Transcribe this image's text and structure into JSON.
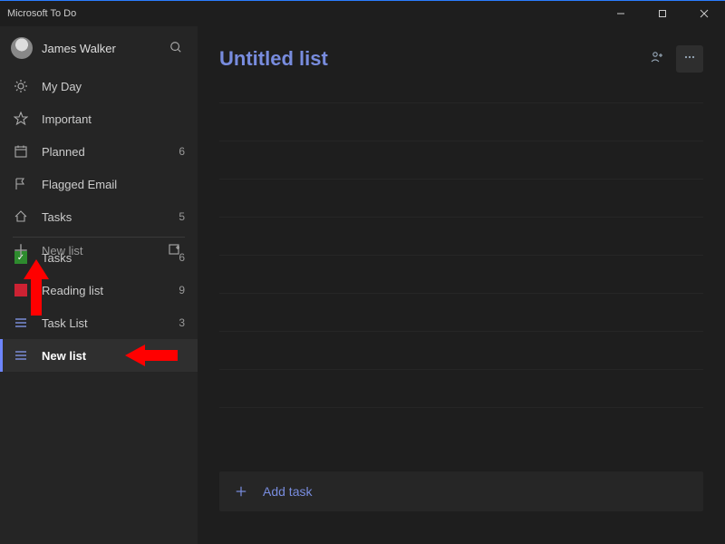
{
  "window": {
    "title": "Microsoft To Do"
  },
  "user": {
    "name": "James Walker"
  },
  "smart_lists": [
    {
      "key": "myday",
      "label": "My Day",
      "count": ""
    },
    {
      "key": "important",
      "label": "Important",
      "count": ""
    },
    {
      "key": "planned",
      "label": "Planned",
      "count": "6"
    },
    {
      "key": "flagged",
      "label": "Flagged Email",
      "count": ""
    },
    {
      "key": "tasks",
      "label": "Tasks",
      "count": "5"
    }
  ],
  "custom_lists": [
    {
      "key": "tasks2",
      "label": "Tasks",
      "count": "6"
    },
    {
      "key": "reading",
      "label": "Reading list",
      "count": "9"
    },
    {
      "key": "tasklist",
      "label": "Task List",
      "count": "3"
    },
    {
      "key": "newlist",
      "label": "New list",
      "count": "",
      "selected": true
    }
  ],
  "newlist": {
    "label": "New list"
  },
  "content": {
    "title": "Untitled list",
    "add_task_label": "Add task"
  }
}
